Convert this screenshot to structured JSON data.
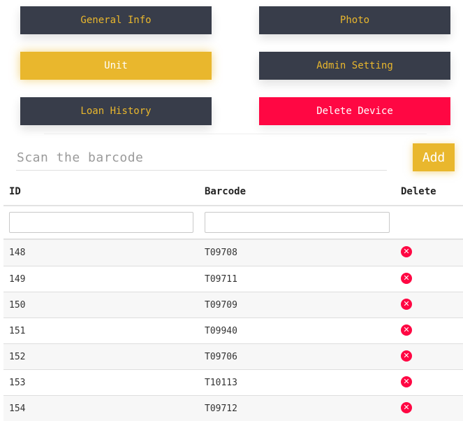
{
  "nav": {
    "general_info": "General Info",
    "photo": "Photo",
    "unit": "Unit",
    "admin_setting": "Admin Setting",
    "loan_history": "Loan History",
    "delete_device": "Delete Device"
  },
  "scan": {
    "placeholder": "Scan the barcode",
    "value": ""
  },
  "add_label": "Add",
  "table": {
    "headers": {
      "id": "ID",
      "barcode": "Barcode",
      "delete": "Delete"
    },
    "filters": {
      "id": "",
      "barcode": ""
    },
    "rows": [
      {
        "id": "148",
        "barcode": "T09708"
      },
      {
        "id": "149",
        "barcode": "T09711"
      },
      {
        "id": "150",
        "barcode": "T09709"
      },
      {
        "id": "151",
        "barcode": "T09940"
      },
      {
        "id": "152",
        "barcode": "T09706"
      },
      {
        "id": "153",
        "barcode": "T10113"
      },
      {
        "id": "154",
        "barcode": "T09712"
      }
    ]
  },
  "colors": {
    "dark_button": "#383d4a",
    "accent_yellow": "#e9b72d",
    "danger_red": "#ff0743"
  },
  "icons": {
    "delete": "close-circle-icon"
  }
}
